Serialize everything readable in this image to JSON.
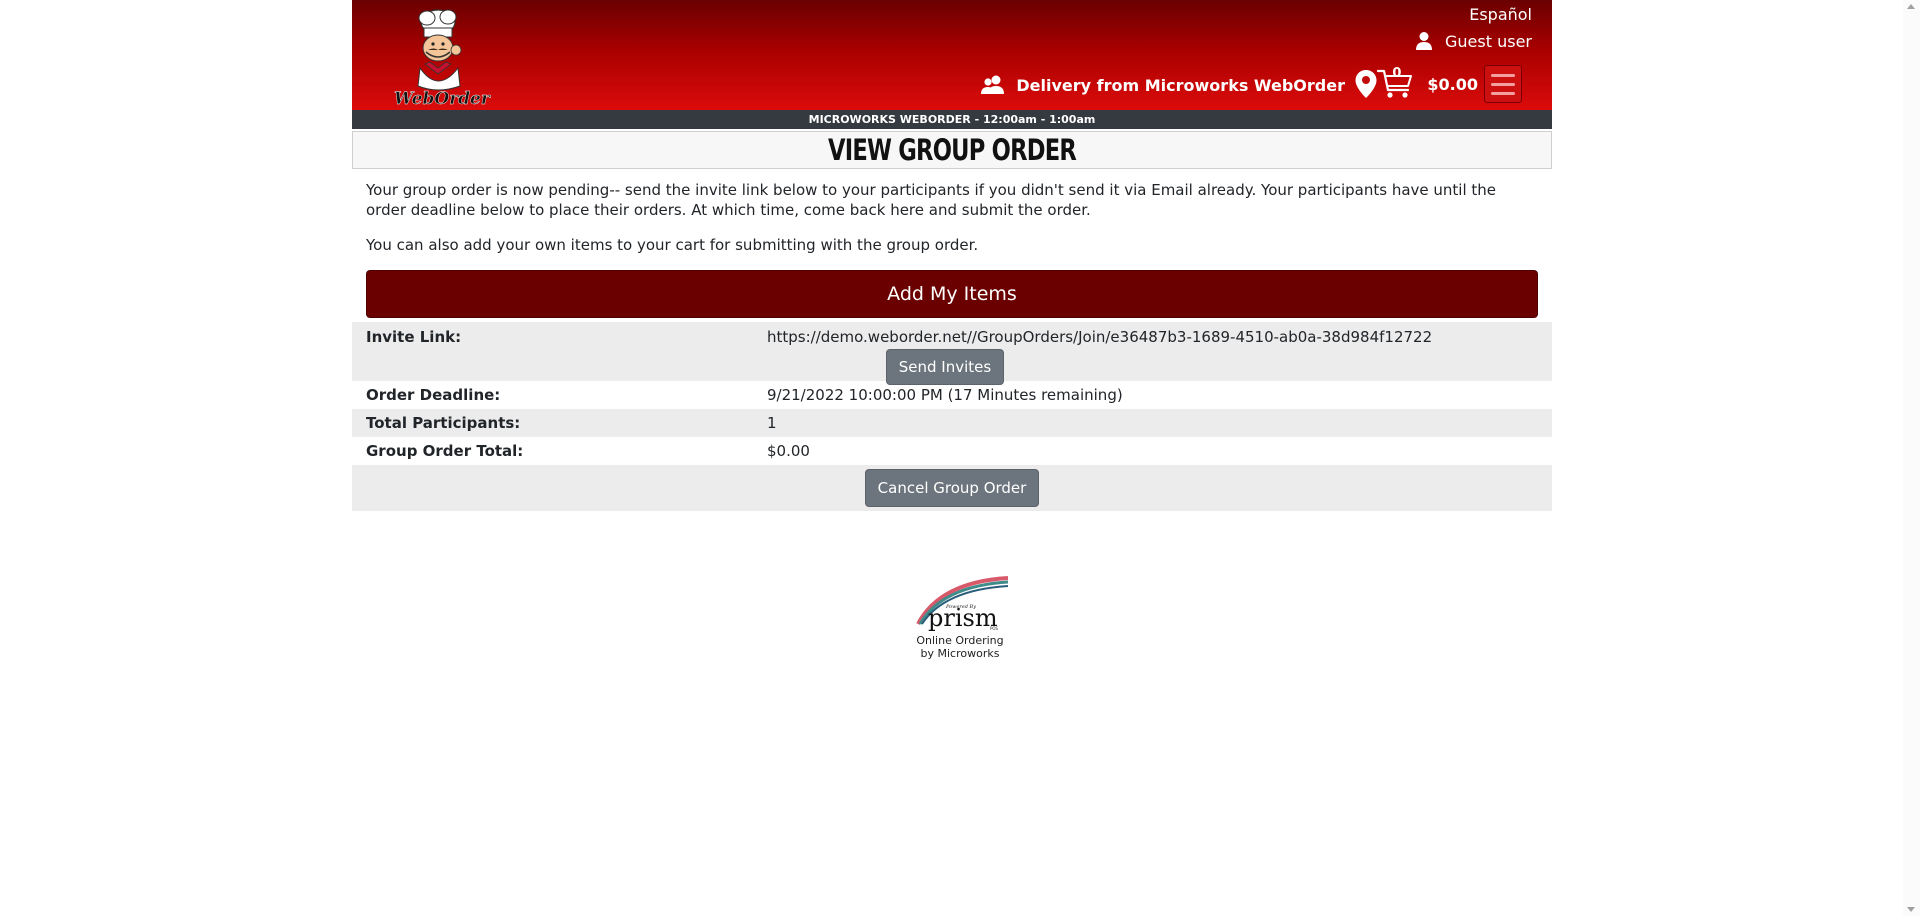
{
  "header": {
    "logo_text": "WebOrder",
    "language_link": "Español",
    "user_label": "Guest user",
    "delivery_label": "Delivery from Microworks WebOrder",
    "cart_count": "0",
    "cart_total": "$0.00"
  },
  "store_bar": {
    "text": "MICROWORKS WEBORDER - 12:00am - 1:00am"
  },
  "page": {
    "title": "View Group Order",
    "intro": "Your group order is now pending-- send the invite link below to your participants if you didn't send it via Email already. Your participants have until the order deadline below to place their orders. At which time, come back here and submit the order.",
    "intro2": "You can also add your own items to your cart for submitting with the group order.",
    "add_items_label": "Add My Items"
  },
  "details": {
    "invite_label": "Invite Link:",
    "invite_value": "https://demo.weborder.net//GroupOrders/Join/e36487b3-1689-4510-ab0a-38d984f12722",
    "send_invites_label": "Send Invites",
    "deadline_label": "Order Deadline:",
    "deadline_value": "9/21/2022 10:00:00 PM (17 Minutes remaining)",
    "participants_label": "Total Participants:",
    "participants_value": "1",
    "total_label": "Group Order Total:",
    "total_value": "$0.00",
    "cancel_label": "Cancel Group Order"
  },
  "footer": {
    "logo_small_text": "Powered By",
    "logo_text": "prism",
    "logo_suffix": "POS",
    "line1": "Online Ordering",
    "line2": "by Microworks"
  },
  "colors": {
    "header_dark": "#6a0000",
    "header_bright": "#dc0b0b",
    "store_bar": "#343a40",
    "primary_button": "#6a0000",
    "secondary_button": "#6c757d",
    "row_stripe": "#ececec"
  },
  "icons": {
    "logo": "chef-mascot-icon",
    "user": "user-icon",
    "delivery": "users-icon",
    "location": "map-pin-icon",
    "cart": "cart-icon",
    "menu": "hamburger-icon"
  }
}
